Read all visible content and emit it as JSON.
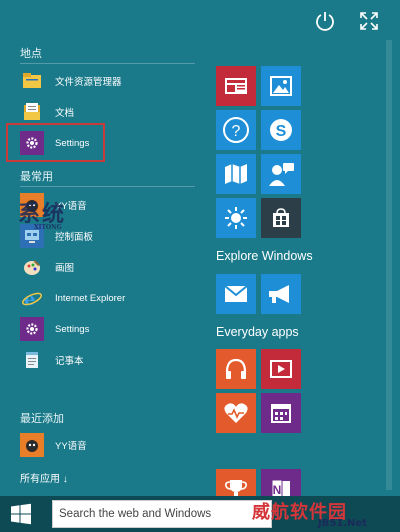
{
  "start_menu": {
    "places_header": "地点",
    "most_used_header": "最常用",
    "recently_added_header": "最近添加",
    "all_apps": "所有应用 ↓",
    "places": [
      {
        "label": "文件资源管理器",
        "icon": "folder-icon"
      },
      {
        "label": "文档",
        "icon": "document-icon"
      },
      {
        "label": "Settings",
        "icon": "gear-icon"
      }
    ],
    "most_used": [
      {
        "label": "YY语音",
        "icon": "yy-icon"
      },
      {
        "label": "控制面板",
        "icon": "control-panel-icon"
      },
      {
        "label": "画图",
        "icon": "paint-icon"
      },
      {
        "label": "Internet Explorer",
        "icon": "ie-icon"
      },
      {
        "label": "Settings",
        "icon": "gear-icon"
      },
      {
        "label": "记事本",
        "icon": "notepad-icon"
      }
    ],
    "recently_added": [
      {
        "label": "YY语音",
        "icon": "yy-icon"
      }
    ]
  },
  "tiles": {
    "explore_label": "Explore Windows",
    "everyday_label": "Everyday apps"
  },
  "taskbar": {
    "search_placeholder": "Search the web and Windows"
  },
  "watermarks": {
    "left": "系统",
    "left_sub": "XITONG",
    "bottom_right": "威航软件园",
    "bottom_right_url": "JB51.Net"
  },
  "colors": {
    "background": "#1a7a8a",
    "highlight_box": "#c93a3a",
    "tile_red": "#c42b3a",
    "tile_blue": "#1e8fd6",
    "tile_orange": "#e35b2c",
    "tile_dark": "#2c3e48",
    "tile_purple": "#6e2b8a"
  }
}
